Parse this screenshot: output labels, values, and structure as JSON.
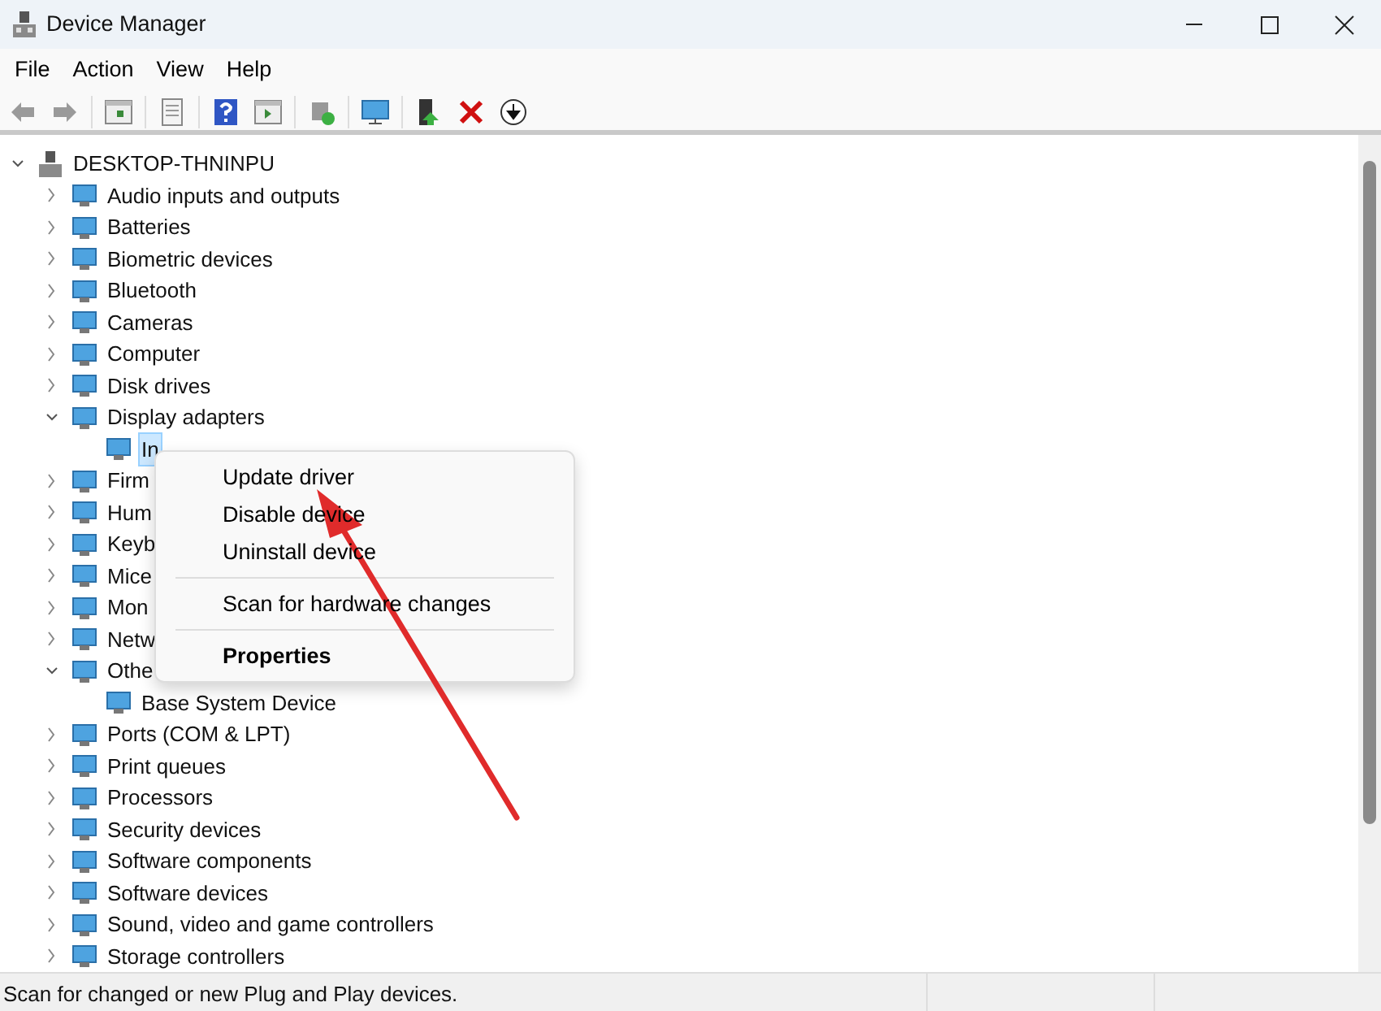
{
  "window": {
    "title": "Device Manager"
  },
  "menu": [
    "File",
    "Action",
    "View",
    "Help"
  ],
  "tree": {
    "label": "DESKTOP-THNINPU",
    "expanded": true,
    "selected": false,
    "children": [
      {
        "label": "Audio inputs and outputs",
        "expanded": false,
        "selected": false
      },
      {
        "label": "Batteries",
        "expanded": false,
        "selected": false
      },
      {
        "label": "Biometric devices",
        "expanded": false,
        "selected": false
      },
      {
        "label": "Bluetooth",
        "expanded": false,
        "selected": false
      },
      {
        "label": "Cameras",
        "expanded": false,
        "selected": false
      },
      {
        "label": "Computer",
        "expanded": false,
        "selected": false
      },
      {
        "label": "Disk drives",
        "expanded": false,
        "selected": false
      },
      {
        "label": "Display adapters",
        "expanded": true,
        "selected": false,
        "children": [
          {
            "label": "In",
            "selected": true
          }
        ]
      },
      {
        "label": "Firm",
        "expanded": false,
        "selected": false
      },
      {
        "label": "Hum",
        "expanded": false,
        "selected": false
      },
      {
        "label": "Keyb",
        "expanded": false,
        "selected": false
      },
      {
        "label": "Mice",
        "expanded": false,
        "selected": false
      },
      {
        "label": "Mon",
        "expanded": false,
        "selected": false
      },
      {
        "label": "Netw",
        "expanded": false,
        "selected": false
      },
      {
        "label": "Othe",
        "expanded": true,
        "selected": false,
        "children": [
          {
            "label": "Base System Device",
            "selected": false
          }
        ]
      },
      {
        "label": "Ports (COM & LPT)",
        "expanded": false,
        "selected": false
      },
      {
        "label": "Print queues",
        "expanded": false,
        "selected": false
      },
      {
        "label": "Processors",
        "expanded": false,
        "selected": false
      },
      {
        "label": "Security devices",
        "expanded": false,
        "selected": false
      },
      {
        "label": "Software components",
        "expanded": false,
        "selected": false
      },
      {
        "label": "Software devices",
        "expanded": false,
        "selected": false
      },
      {
        "label": "Sound, video and game controllers",
        "expanded": false,
        "selected": false
      },
      {
        "label": "Storage controllers",
        "expanded": false,
        "selected": false
      }
    ]
  },
  "context_menu": [
    {
      "kind": "item",
      "label": "Update driver",
      "default": false
    },
    {
      "kind": "item",
      "label": "Disable device",
      "default": false
    },
    {
      "kind": "item",
      "label": "Uninstall device",
      "default": false
    },
    {
      "kind": "separator"
    },
    {
      "kind": "item",
      "label": "Scan for hardware changes",
      "default": false
    },
    {
      "kind": "separator"
    },
    {
      "kind": "item",
      "label": "Properties",
      "default": true
    }
  ],
  "status_bar": "Scan for changed or new Plug and Play devices."
}
